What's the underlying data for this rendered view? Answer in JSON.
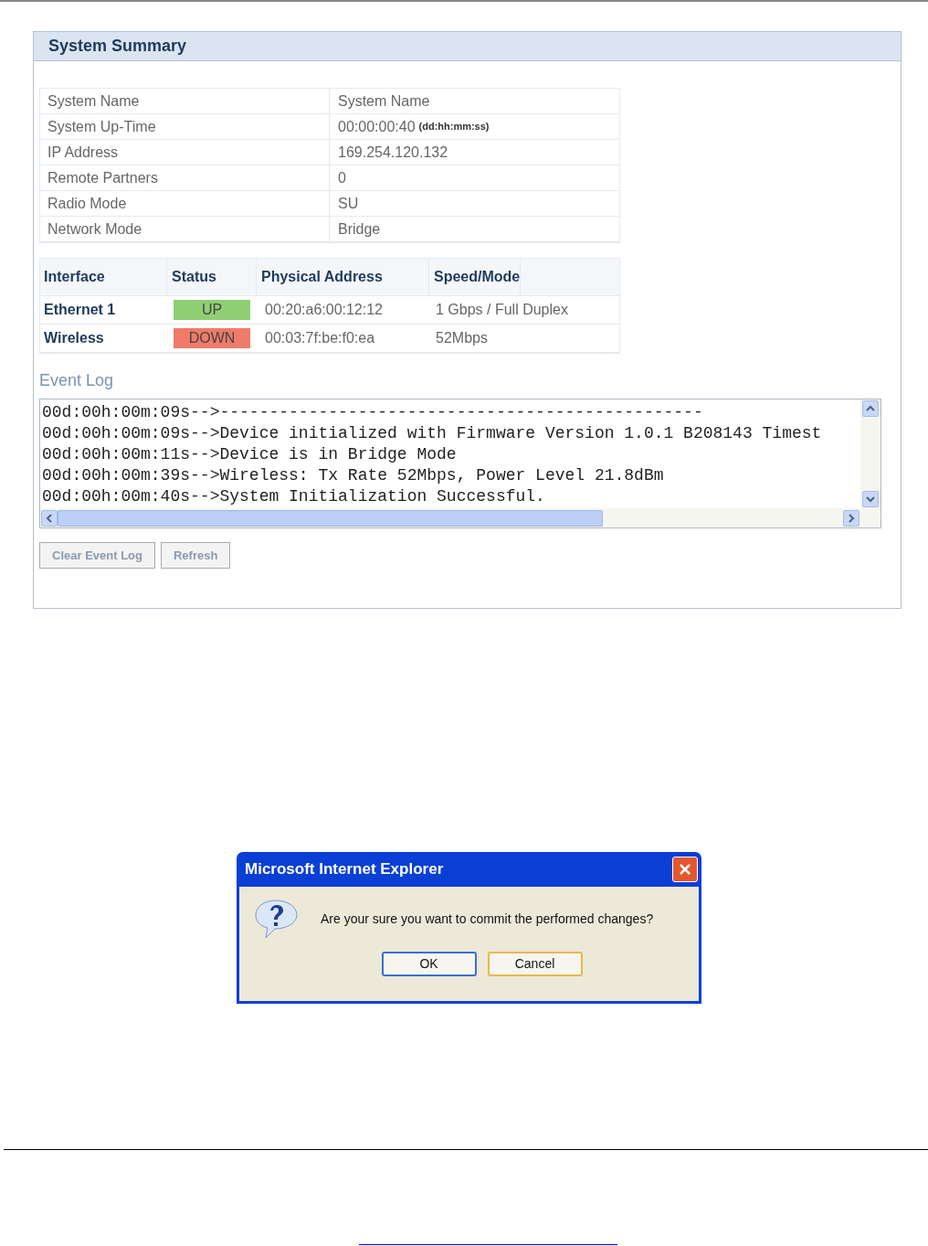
{
  "system_summary": {
    "title": "System Summary",
    "info_rows": [
      {
        "label": "System Name",
        "value": "System Name"
      },
      {
        "label": "System Up-Time",
        "value": "00:00:00:40",
        "unit": "(dd:hh:mm:ss)"
      },
      {
        "label": "IP Address",
        "value": "169.254.120.132"
      },
      {
        "label": "Remote Partners",
        "value": "0"
      },
      {
        "label": "Radio Mode",
        "value": "SU"
      },
      {
        "label": "Network Mode",
        "value": "Bridge"
      }
    ],
    "interfaces": {
      "columns": [
        "Interface",
        "Status",
        "Physical Address",
        "Speed/Mode"
      ],
      "rows": [
        {
          "interface": "Ethernet 1",
          "status": "UP",
          "color": "#8fcf73",
          "address": "00:20:a6:00:12:12",
          "speed": "1 Gbps / Full Duplex"
        },
        {
          "interface": "Wireless",
          "status": "DOWN",
          "color": "#ef7b68",
          "address": "00:03:7f:be:f0:ea",
          "speed": "52Mbps"
        }
      ]
    },
    "event_log": {
      "title": "Event Log",
      "lines": [
        "00d:00h:00m:09s-->-------------------------------------------------",
        "00d:00h:00m:09s-->Device initialized with Firmware Version 1.0.1 B208143 Timest",
        "00d:00h:00m:11s-->Device is in Bridge Mode",
        "00d:00h:00m:39s-->Wireless: Tx Rate 52Mbps, Power Level 21.8dBm",
        "00d:00h:00m:40s-->System Initialization Successful."
      ]
    },
    "buttons": [
      "Clear Event Log",
      "Refresh"
    ]
  },
  "dialog": {
    "title": "Microsoft Internet Explorer",
    "message": "Are your sure you want to commit the performed changes?",
    "buttons": [
      {
        "label": "OK",
        "selected": true
      },
      {
        "label": "Cancel",
        "selected": false
      }
    ]
  }
}
